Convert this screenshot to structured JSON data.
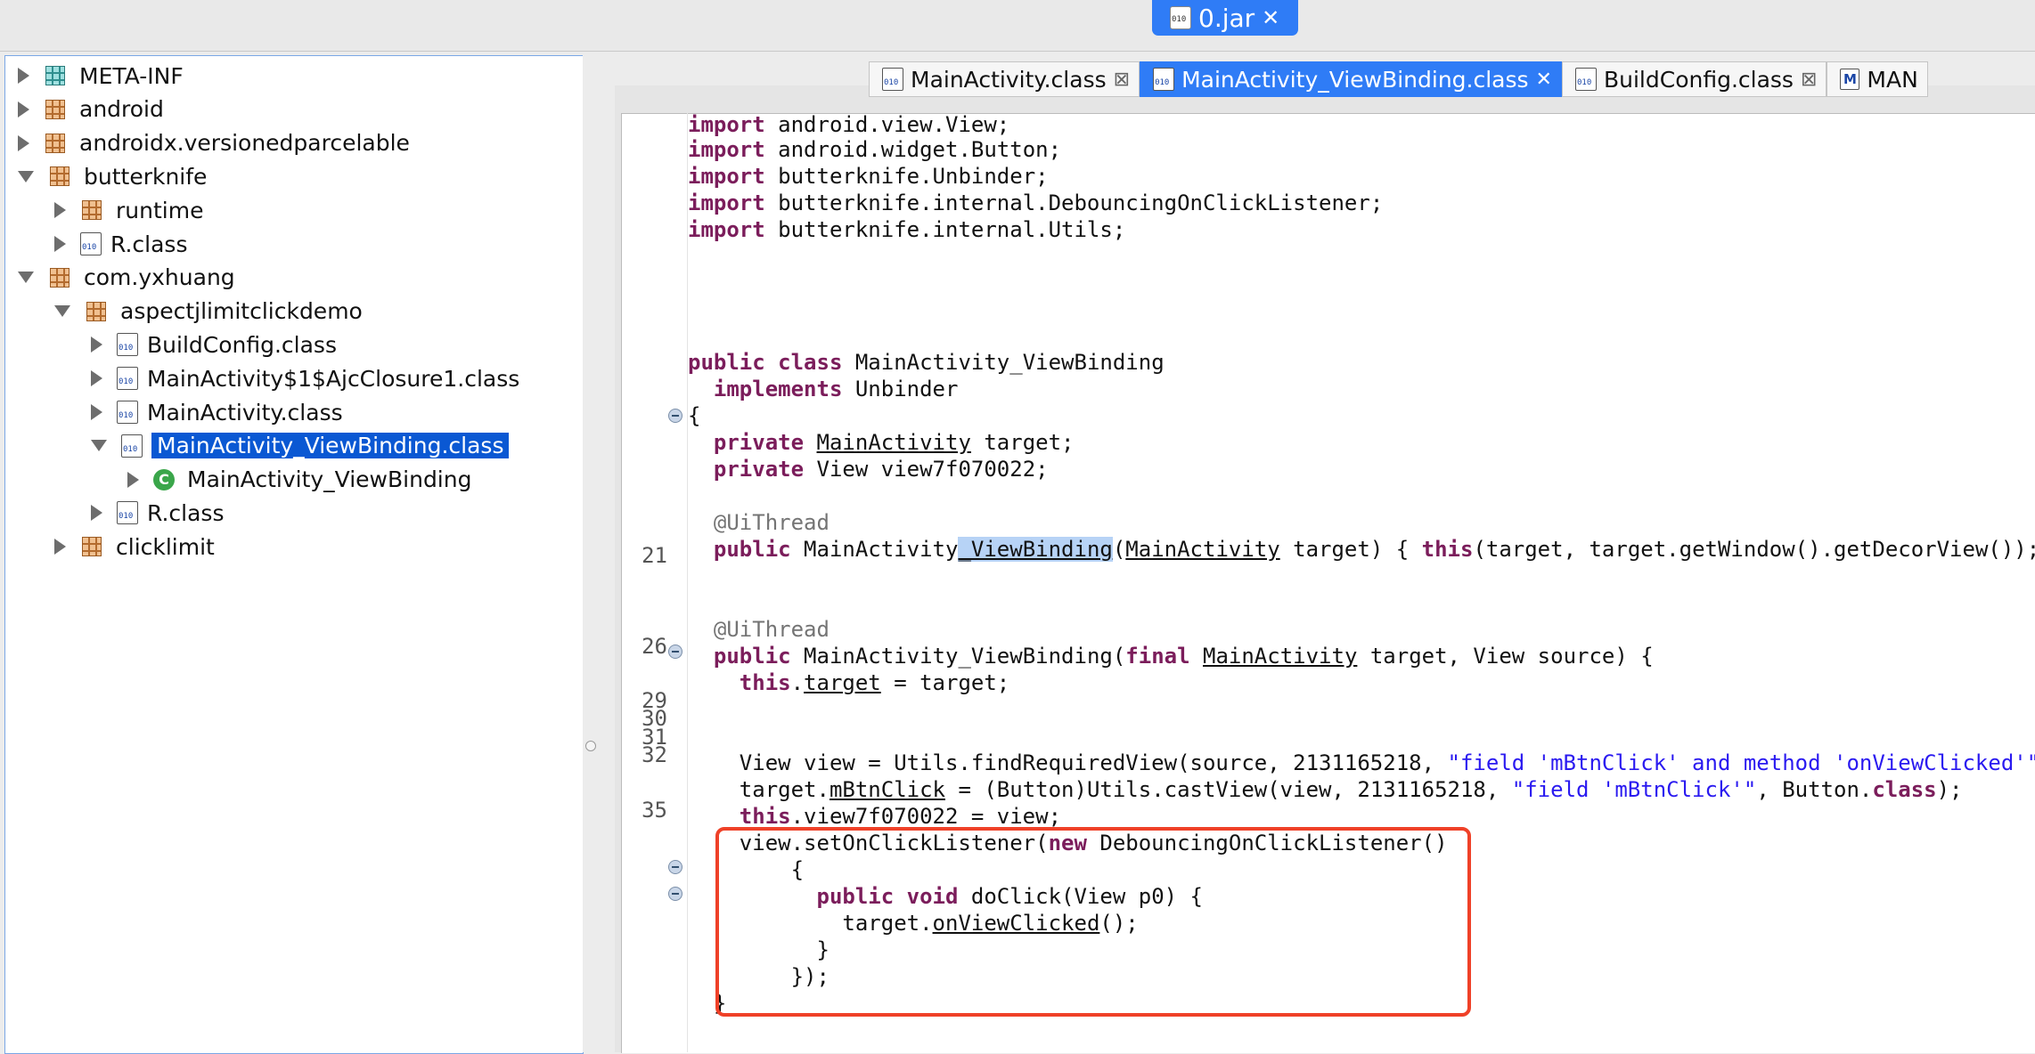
{
  "top_tab": {
    "label": "0.jar"
  },
  "tree": {
    "nodes": [
      {
        "label": "META-INF",
        "kind": "package-teal",
        "expanded": false
      },
      {
        "label": "android",
        "kind": "package",
        "expanded": false
      },
      {
        "label": "androidx.versionedparcelable",
        "kind": "package",
        "expanded": false
      },
      {
        "label": "butterknife",
        "kind": "package",
        "expanded": true
      },
      {
        "label": "runtime",
        "kind": "package",
        "expanded": false
      },
      {
        "label": "R.class",
        "kind": "class",
        "expanded": false
      },
      {
        "label": "com.yxhuang",
        "kind": "package",
        "expanded": true
      },
      {
        "label": "aspectjlimitclickdemo",
        "kind": "package",
        "expanded": true
      },
      {
        "label": "BuildConfig.class",
        "kind": "class",
        "expanded": false
      },
      {
        "label": "MainActivity$1$AjcClosure1.class",
        "kind": "class",
        "expanded": false
      },
      {
        "label": "MainActivity.class",
        "kind": "class",
        "expanded": false
      },
      {
        "label": "MainActivity_ViewBinding.class",
        "kind": "class",
        "expanded": true,
        "selected": true
      },
      {
        "label": "MainActivity_ViewBinding",
        "kind": "type",
        "expanded": false
      },
      {
        "label": "R.class",
        "kind": "class",
        "expanded": false
      },
      {
        "label": "clicklimit",
        "kind": "package",
        "expanded": false
      }
    ]
  },
  "editor_tabs": [
    {
      "label": "MainActivity.class",
      "active": false
    },
    {
      "label": "MainActivity_ViewBinding.class",
      "active": true
    },
    {
      "label": "BuildConfig.class",
      "active": false
    },
    {
      "label": "MAN",
      "active": false,
      "icon_letter": "M"
    }
  ],
  "code": {
    "line_numbers": [
      "21",
      "26",
      "29",
      "30",
      "31",
      "32",
      "35"
    ],
    "tokens": {
      "import": "import",
      "imp1": " android.view.View;",
      "imp2": " android.widget.Button;",
      "imp3": " butterknife.Unbinder;",
      "imp4": " butterknife.internal.DebouncingOnClickListener;",
      "imp5": " butterknife.internal.Utils;",
      "public": "public",
      "class": "class",
      "private": "private",
      "implements": "implements",
      "final": "final",
      "this": "this",
      "new": "new",
      "void": "void",
      "l_class_rest": " MainActivity_ViewBinding",
      "l_impl_rest": " Unbinder",
      "l_brace": "{",
      "l_f1_type": "MainActivity",
      "l_f1_rest": " target;",
      "l_f2_rest": " View view7f070022;",
      "anno": "@UiThread",
      "l21_a": " MainActivity",
      "l21_hl": "_ViewBinding",
      "l21_b": "(",
      "l21_type": "MainActivity",
      "l21_c": " target) { ",
      "l21_d": "(target, target.getWindow().getDecorView()); }",
      "l25_a": " MainActivity_ViewBinding(",
      "l25_type": "MainActivity",
      "l25_b": " target, View source) {",
      "l26_a": ".",
      "l26_field": "target",
      "l26_b": " = target;",
      "l29_a": "View view = Utils.findRequiredView(source, 2131165218, ",
      "l29_str": "\"field 'mBtnClick' and method 'onViewClicked'\"",
      "l29_b": ");",
      "l30_a": "target.",
      "l30_field": "mBtnClick",
      "l30_b": " = (Button)Utils.castView(view, 2131165218, ",
      "l30_str": "\"field 'mBtnClick'\"",
      "l30_c": ", Button.",
      "l30_d": ");",
      "l31_a": ".view7f070022 = view;",
      "l32_a": "view.setOnClickListener(",
      "l32_b": " DebouncingOnClickListener()",
      "l33": "{",
      "l34_a": " doClick(View p0) {",
      "l35_a": "target.",
      "l35_m": "onViewClicked",
      "l35_b": "();",
      "l36": "}",
      "l37": "});",
      "l38": "}"
    }
  },
  "colors": {
    "keyword": "#7b1d5b",
    "string": "#2a1af0",
    "annotation": "#747474",
    "selection": "#0a58d3",
    "active_tab": "#2f7cf6",
    "callout_box": "#ef4128"
  }
}
